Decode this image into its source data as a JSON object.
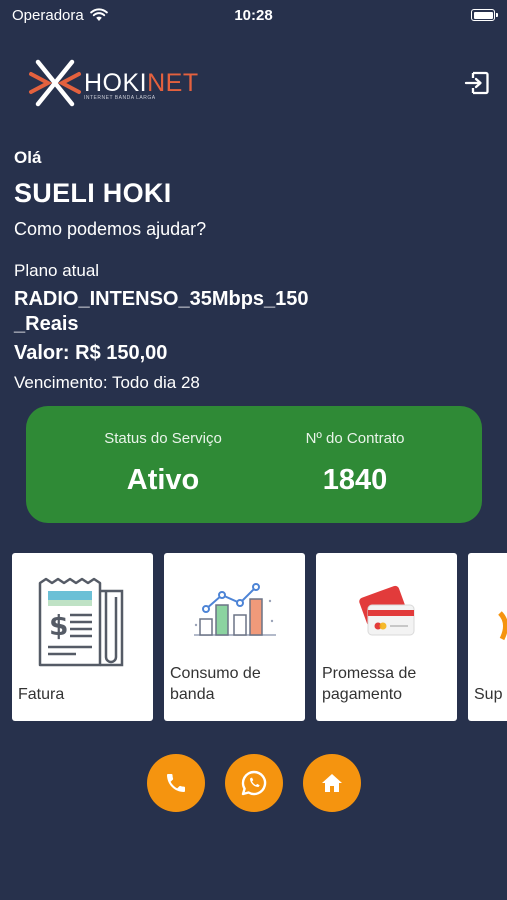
{
  "status_bar": {
    "carrier": "Operadora",
    "time": "10:28"
  },
  "header": {
    "logo_main": "HOKI",
    "logo_accent": "NET",
    "logo_tagline": "INTERNET BANDA LARGA"
  },
  "user": {
    "greeting": "Olá",
    "name": "SUELI HOKI",
    "help_prompt": "Como podemos ajudar?"
  },
  "plan": {
    "label": "Plano atual",
    "name": "RADIO_INTENSO_35Mbps_150_Reais",
    "value": "Valor: R$ 150,00",
    "due": "Vencimento: Todo dia 28"
  },
  "service_card": {
    "status_label": "Status do Serviço",
    "status_value": "Ativo",
    "contract_label": "Nº do Contrato",
    "contract_value": "1840",
    "color": "#2f8a36"
  },
  "tiles": [
    {
      "label": "Fatura",
      "icon": "invoice-icon"
    },
    {
      "label": "Consumo de banda",
      "icon": "bar-chart-icon"
    },
    {
      "label": "Promessa de pagamento",
      "icon": "credit-card-icon"
    },
    {
      "label": "Sup",
      "icon": "support-icon"
    }
  ],
  "actions": [
    {
      "icon": "phone-icon"
    },
    {
      "icon": "whatsapp-icon"
    },
    {
      "icon": "home-icon"
    }
  ],
  "colors": {
    "background": "#27314c",
    "accent": "#f5940f",
    "brand": "#e4613e"
  }
}
